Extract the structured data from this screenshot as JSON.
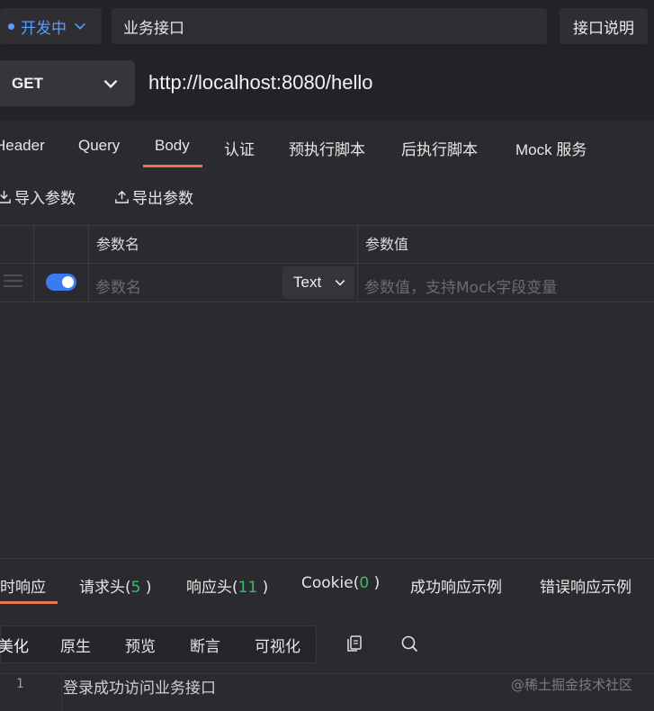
{
  "topbar": {
    "status_label": "开发中",
    "api_name": "业务接口",
    "doc_button": "接口说明"
  },
  "request": {
    "method": "GET",
    "url": "http://localhost:8080/hello"
  },
  "request_tabs": [
    "Header",
    "Query",
    "Body",
    "认证",
    "预执行脚本",
    "后执行脚本",
    "Mock 服务"
  ],
  "active_request_tab": "Body",
  "params": {
    "import_label": "导入参数",
    "export_label": "导出参数",
    "col_name": "参数名",
    "col_value": "参数值",
    "row": {
      "enabled": true,
      "name_placeholder": "参数名",
      "type": "Text",
      "value_placeholder": "参数值，支持Mock字段变量"
    }
  },
  "response": {
    "tabs": {
      "realtime": "实时响应",
      "req_headers_label": "请求头(",
      "req_headers_count": "5",
      "resp_headers_label": "响应头(",
      "resp_headers_count": "11",
      "cookie_label": "Cookie(",
      "cookie_count": "0",
      "close_paren": " )",
      "success_example": "成功响应示例",
      "error_example": "错误响应示例"
    },
    "views": [
      "美化",
      "原生",
      "预览",
      "断言",
      "可视化"
    ],
    "active_view": "美化",
    "line_number": "1",
    "body": "登录成功访问业务接口"
  },
  "watermark": "@稀土掘金技术社区",
  "colors": {
    "accent": "#e8754d",
    "status_blue": "#5b9bff",
    "toggle_on": "#3a7bf0",
    "count_green": "#41b86b"
  }
}
